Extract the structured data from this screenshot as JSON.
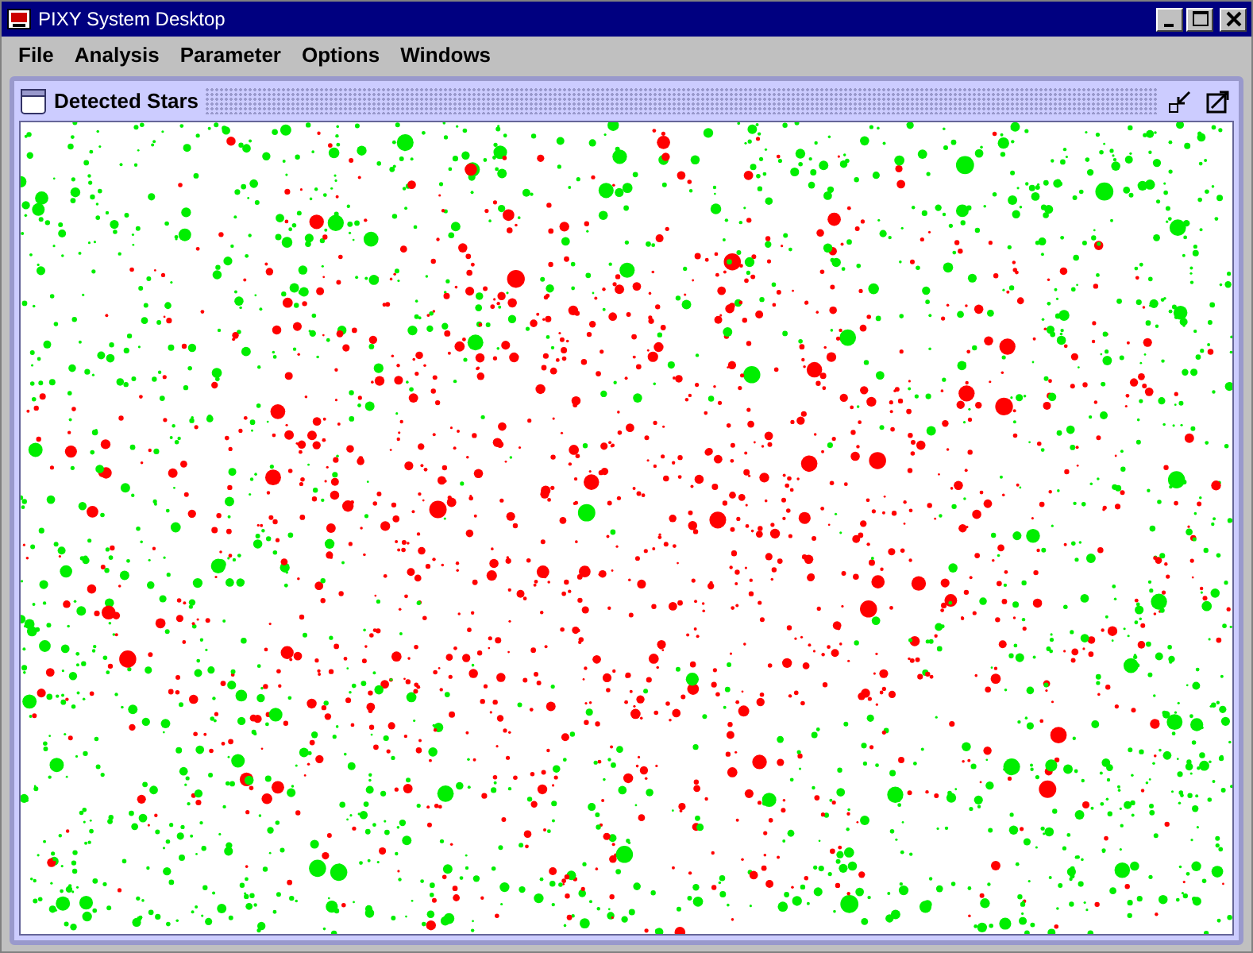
{
  "window": {
    "title": "PIXY System Desktop"
  },
  "menu": [
    "File",
    "Analysis",
    "Parameter",
    "Options",
    "Windows"
  ],
  "internal_frame": {
    "title": "Detected Stars"
  }
}
